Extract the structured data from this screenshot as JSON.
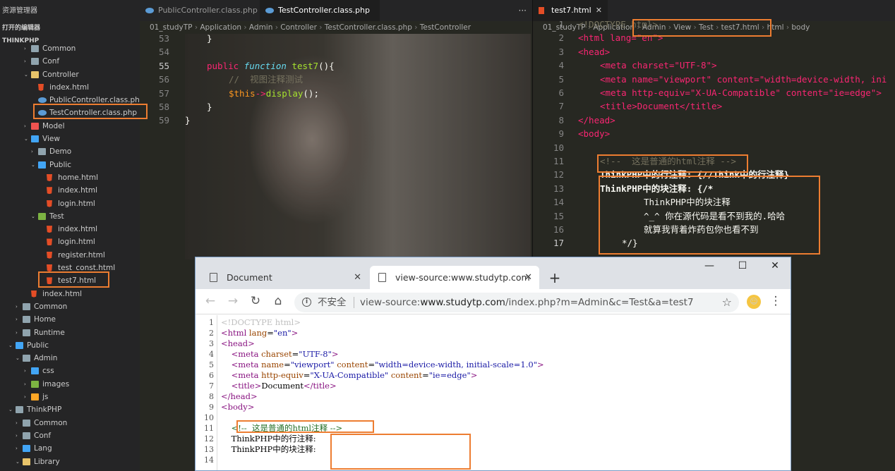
{
  "sidebar": {
    "header": "资源管理器",
    "open_editors": "打开的编辑器",
    "project": "THINKPHP",
    "items": [
      {
        "label": "Common",
        "depth": 3,
        "kind": "folder",
        "arrow": "›"
      },
      {
        "label": "Conf",
        "depth": 3,
        "kind": "folder",
        "arrow": "›"
      },
      {
        "label": "Controller",
        "depth": 3,
        "kind": "folder-open",
        "arrow": "⌄"
      },
      {
        "label": "index.html",
        "depth": 4,
        "kind": "html"
      },
      {
        "label": "PublicController.class.php",
        "depth": 4,
        "kind": "php"
      },
      {
        "label": "TestController.class.php",
        "depth": 4,
        "kind": "php",
        "highlight": true
      },
      {
        "label": "Model",
        "depth": 3,
        "kind": "folder-red",
        "arrow": "›"
      },
      {
        "label": "View",
        "depth": 3,
        "kind": "folder-blue",
        "arrow": "⌄"
      },
      {
        "label": "Demo",
        "depth": 4,
        "kind": "folder",
        "arrow": "›"
      },
      {
        "label": "Public",
        "depth": 4,
        "kind": "folder-blue",
        "arrow": "⌄"
      },
      {
        "label": "home.html",
        "depth": 5,
        "kind": "html"
      },
      {
        "label": "index.html",
        "depth": 5,
        "kind": "html"
      },
      {
        "label": "login.html",
        "depth": 5,
        "kind": "html"
      },
      {
        "label": "Test",
        "depth": 4,
        "kind": "folder-green",
        "arrow": "⌄"
      },
      {
        "label": "index.html",
        "depth": 5,
        "kind": "html"
      },
      {
        "label": "login.html",
        "depth": 5,
        "kind": "html"
      },
      {
        "label": "register.html",
        "depth": 5,
        "kind": "html"
      },
      {
        "label": "test_const.html",
        "depth": 5,
        "kind": "html"
      },
      {
        "label": "test7.html",
        "depth": 5,
        "kind": "html",
        "highlight": true
      },
      {
        "label": "index.html",
        "depth": 3,
        "kind": "html"
      },
      {
        "label": "Common",
        "depth": 2,
        "kind": "folder",
        "arrow": "›"
      },
      {
        "label": "Home",
        "depth": 2,
        "kind": "folder",
        "arrow": "›"
      },
      {
        "label": "Runtime",
        "depth": 2,
        "kind": "folder",
        "arrow": "›"
      },
      {
        "label": "Public",
        "depth": 1,
        "kind": "folder-blue",
        "arrow": "⌄"
      },
      {
        "label": "Admin",
        "depth": 2,
        "kind": "folder",
        "arrow": "⌄"
      },
      {
        "label": "css",
        "depth": 3,
        "kind": "folder-blue",
        "arrow": "›"
      },
      {
        "label": "images",
        "depth": 3,
        "kind": "folder-green",
        "arrow": "›"
      },
      {
        "label": "js",
        "depth": 3,
        "kind": "folder-orange",
        "arrow": "›"
      },
      {
        "label": "ThinkPHP",
        "depth": 1,
        "kind": "folder",
        "arrow": "⌄"
      },
      {
        "label": "Common",
        "depth": 2,
        "kind": "folder",
        "arrow": "›"
      },
      {
        "label": "Conf",
        "depth": 2,
        "kind": "folder",
        "arrow": "›"
      },
      {
        "label": "Lang",
        "depth": 2,
        "kind": "folder-blue",
        "arrow": "›"
      },
      {
        "label": "Library",
        "depth": 2,
        "kind": "folder-open",
        "arrow": "⌄"
      }
    ]
  },
  "editor1": {
    "tabs": [
      {
        "label": "PublicController.class.php",
        "active": false
      },
      {
        "label": "TestController.class.php",
        "active": true
      }
    ],
    "more_icon": "···",
    "breadcrumb": [
      "01_studyTP",
      "Application",
      "Admin",
      "Controller",
      "TestController.class.php",
      "TestController"
    ],
    "line_numbers": [
      "53",
      "54",
      "55",
      "56",
      "57",
      "58",
      "59"
    ]
  },
  "editor2": {
    "tab": "test7.html",
    "breadcrumb": [
      "01_studyTP",
      "Application",
      "Admin",
      "View",
      "Test",
      "test7.html",
      "html",
      "body"
    ],
    "line_numbers": [
      "1",
      "2",
      "3",
      "4",
      "5",
      "6",
      "7",
      "8",
      "9",
      "10",
      "11",
      "12",
      "13",
      "14",
      "15",
      "16",
      "17"
    ],
    "line1": "<!DOCTYPE html>",
    "html_open": "<html lang=\"en\">",
    "head_open": "<head>",
    "meta_charset": "<meta charset=\"UTF-8\">",
    "meta_viewport": "<meta name=\"viewport\" content=\"width=device-width, ini",
    "meta_compat": "<meta http-equiv=\"X-UA-Compatible\" content=\"ie=edge\">",
    "title_line": "<title>Document</title>",
    "head_close": "</head>",
    "body_open": "<body>",
    "html_comment": "<!--  这是普通的html注释 -->",
    "line_comment": "ThinkPHP中的行注释: {//Think中的行注释}",
    "block_comment_start": "ThinkPHP中的块注释: {/*",
    "block_line1": "ThinkPHP中的块注释",
    "block_line2": "^_^ 你在源代码是看不到我的.哈哈",
    "block_line3": "就算我背着炸药包你也看不到",
    "block_end": "*/}"
  },
  "code1": {
    "l53": "}",
    "l55_kw": "public",
    "l55_fn_kw": "function",
    "l55_name": "test7",
    "l55_rest": "(){",
    "l56": "//  视图注释测试",
    "l57_var": "$this",
    "l57_arrow": "->",
    "l57_call": "display",
    "l57_rest": "();",
    "l58": "}",
    "l59": "}"
  },
  "browser": {
    "tabs": [
      {
        "label": "Document",
        "active": false
      },
      {
        "label": "view-source:www.studytp.com",
        "active": true
      }
    ],
    "new_tab": "+",
    "window_controls": {
      "minimize": "—",
      "maximize": "☐",
      "close": "✕"
    },
    "nav": {
      "back": "←",
      "forward": "→",
      "reload": "↻",
      "home": "⌂"
    },
    "insecure_label": "不安全",
    "url_prefix": "view-source:",
    "url_host": "www.studytp.com",
    "url_path": "/index.php?m=Admin&c=Test&a=test7",
    "star_icon": "☆",
    "menu_icon": "⋮",
    "source_line_numbers": [
      "1",
      "2",
      "3",
      "4",
      "5",
      "6",
      "7",
      "8",
      "9",
      "10",
      "11",
      "12",
      "13",
      "14"
    ],
    "source": {
      "doctype": "<!DOCTYPE html>",
      "html_open_tag": "<html ",
      "lang_attr": "lang",
      "lang_val": "\"en\"",
      "head_open": "<head>",
      "meta1": "<meta ",
      "charset_attr": "charset",
      "charset_val": "\"UTF-8\"",
      "name_attr": "name",
      "name_val": "\"viewport\"",
      "content_attr": "content",
      "content_val": "\"width=device-width, initial-scale=1.0\"",
      "httpequiv_attr": "http-equiv",
      "httpequiv_val": "\"X-UA-Compatible\"",
      "ie_val": "\"ie=edge\"",
      "title_open": "<title>",
      "title_text": "Document",
      "title_close": "</title>",
      "head_close": "</head>",
      "body_open": "<body>",
      "comment": "<!--  这是普通的html注释 -->",
      "line12": "ThinkPHP中的行注释:",
      "line13": "ThinkPHP中的块注释:"
    }
  },
  "colors": {
    "highlight": "#ed7d31",
    "sidebar_bg": "#252526",
    "editor_bg": "#272822"
  }
}
